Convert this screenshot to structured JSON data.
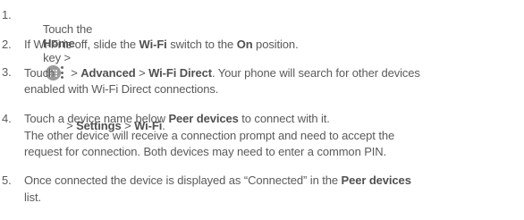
{
  "steps": [
    {
      "number": "1.",
      "pre": "Touch the",
      "home_key": "Home",
      "key_text": "key >",
      "sep1": "> ",
      "settings": "Settings",
      "sep2": " > ",
      "wifi": "Wi-Fi",
      "end": "."
    },
    {
      "number": "2.",
      "pre": "If Wi-Fi is off, slide the ",
      "wifi": "Wi-Fi",
      "mid": " switch to the ",
      "on": "On",
      "end": " position."
    },
    {
      "number": "3.",
      "pre": "Touch",
      "sep1": "> ",
      "advanced": "Advanced",
      "sep2": " > ",
      "wifi_direct": "Wi-Fi Direct",
      "rest": ". Your phone will search for other devices",
      "line2": "enabled with Wi-Fi Direct connections."
    },
    {
      "number": "4.",
      "pre": "Touch a device name below ",
      "peer_devices": "Peer devices",
      "rest": " to connect with it.",
      "line2": "The other device will receive a connection prompt and need to accept the",
      "line3": "request for connection. Both devices may need to enter a common PIN."
    },
    {
      "number": "5.",
      "pre": "Once connected the device is displayed as “Connected” in the ",
      "peer_devices": "Peer devices",
      "line2": "list."
    }
  ],
  "icons": {
    "home_key": "apps-launcher-icon",
    "menu_key": "overflow-menu-icon"
  },
  "colors": {
    "text": "#5a5a5a",
    "icon_fill": "#9a9a9a"
  }
}
